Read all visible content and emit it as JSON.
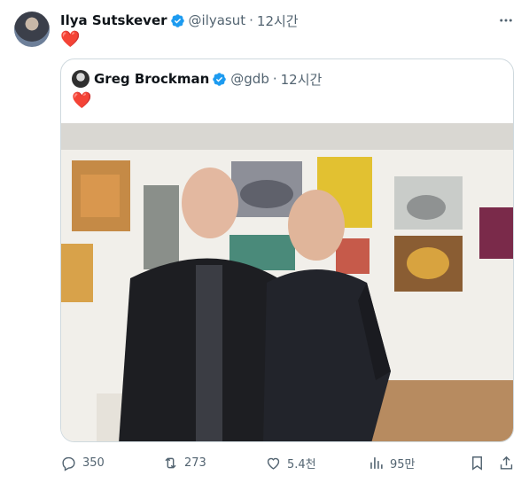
{
  "tweet": {
    "author_name": "Ilya Sutskever",
    "author_handle": "@ilyasut",
    "separator": "·",
    "time": "12시간",
    "text_emoji": "❤️"
  },
  "quote": {
    "author_name": "Greg Brockman",
    "author_handle": "@gdb",
    "separator": "·",
    "time": "12시간",
    "text_emoji": "❤️"
  },
  "actions": {
    "replies": "350",
    "reposts": "273",
    "likes": "5.4천",
    "views": "95만"
  },
  "colors": {
    "verified": "#1d9bf0",
    "heart": "#f91880",
    "muted": "#536471",
    "border": "#cfd9de"
  }
}
